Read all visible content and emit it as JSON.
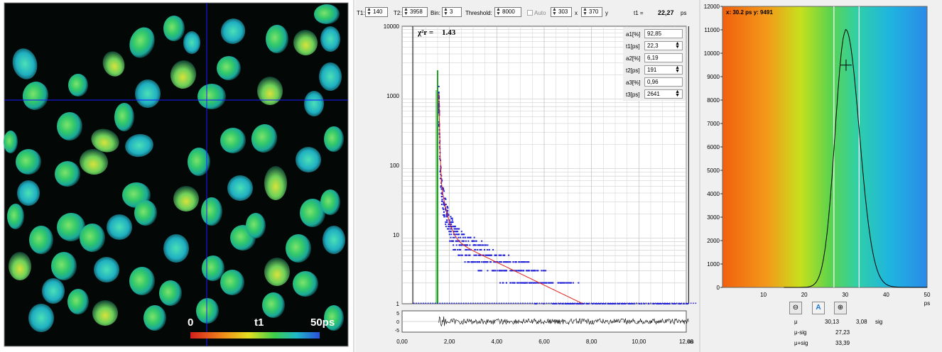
{
  "image_panel": {
    "scale_min": "0",
    "scale_mid": "t1",
    "scale_max": "50ps"
  },
  "decay_panel": {
    "toolbar": {
      "t1_label": "T1:",
      "t1_value": "140",
      "t2_label": "T2:",
      "t2_value": "3958",
      "bin_label": "Bin:",
      "bin_value": "3",
      "threshold_label": "Threshold:",
      "threshold_value": "8000",
      "auto_label": "Auto",
      "x_value": "303",
      "x_label": "x",
      "y_value": "370",
      "y_label": "y",
      "t1_result_label": "t1 =",
      "t1_result_value": "22,27",
      "t1_result_unit": "ps"
    },
    "chi_label": "χ²r =",
    "chi_value": "1.43",
    "fit_params": [
      {
        "label": "a1[%]",
        "value": "92,85",
        "spin": false
      },
      {
        "label": "t1[ps]",
        "value": "22,3",
        "spin": true
      },
      {
        "label": "a2[%]",
        "value": "6,19",
        "spin": false
      },
      {
        "label": "t2[ps]",
        "value": "191",
        "spin": true
      },
      {
        "label": "a3[%]",
        "value": "0,96",
        "spin": false
      },
      {
        "label": "t3[ps]",
        "value": "2641",
        "spin": true
      }
    ],
    "y_ticks": [
      "10000",
      "1000",
      "100",
      "10",
      "1"
    ],
    "x_ticks": [
      "0,00",
      "2,00",
      "4,00",
      "6,00",
      "8,00",
      "10,00",
      "12,00"
    ],
    "x_unit": "ns",
    "residual_ticks": [
      "5",
      "0",
      "-5"
    ],
    "colors": {
      "data": "#1f1fd6",
      "fit": "#e0201a",
      "irf": "#1fa51f"
    }
  },
  "histogram_panel": {
    "cursor_readout": "x: 30.2  ps    y: 9491",
    "y_ticks": [
      "12000",
      "11000",
      "10000",
      "9000",
      "8000",
      "7000",
      "6000",
      "5000",
      "4000",
      "3000",
      "2000",
      "1000",
      "0"
    ],
    "x_ticks": [
      "10",
      "20",
      "30",
      "40",
      "50"
    ],
    "x_unit": "ps",
    "stats": {
      "mu_label": "μ",
      "mu_value": "30,13",
      "sig_value": "3,08",
      "sig_label": "sig",
      "mu_minus_label": "μ-sig",
      "mu_minus_value": "27,23",
      "mu_plus_label": "μ+sig",
      "mu_plus_value": "33,39"
    }
  }
}
